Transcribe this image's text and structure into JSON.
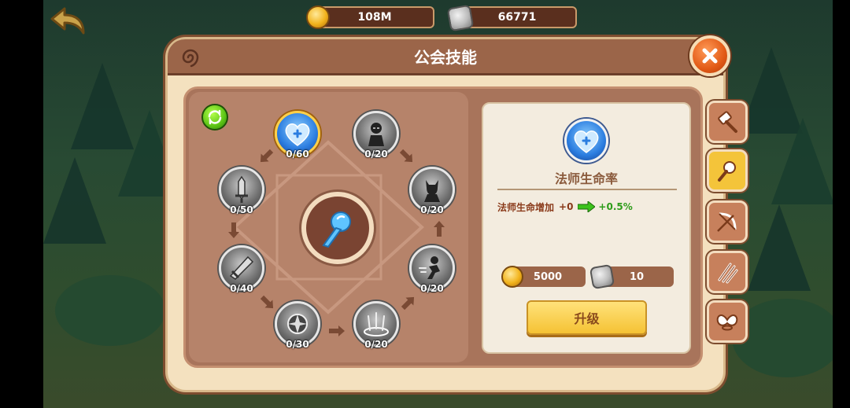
{
  "resources": {
    "gold": "108M",
    "stone": "66771"
  },
  "panel": {
    "title": "公会技能"
  },
  "skills": [
    {
      "name": "mage-health",
      "count": "0/60",
      "active": true
    },
    {
      "name": "assassin",
      "count": "0/20",
      "active": false
    },
    {
      "name": "shadow-warrior",
      "count": "0/20",
      "active": false
    },
    {
      "name": "dash",
      "count": "0/20",
      "active": false
    },
    {
      "name": "shockwave",
      "count": "0/20",
      "active": false
    },
    {
      "name": "spin",
      "count": "0/30",
      "active": false
    },
    {
      "name": "blade",
      "count": "0/40",
      "active": false
    },
    {
      "name": "shield-sword",
      "count": "0/50",
      "active": false
    }
  ],
  "detail": {
    "name": "法师生命率",
    "effect_label": "法师生命增加",
    "effect_current": "+0",
    "effect_next": "+0.5%",
    "cost_gold": "5000",
    "cost_stone": "10",
    "upgrade_label": "升级"
  },
  "side_tabs": [
    {
      "icon": "hammer-icon",
      "active": false
    },
    {
      "icon": "wand-icon",
      "active": true
    },
    {
      "icon": "bow-icon",
      "active": false
    },
    {
      "icon": "claw-icon",
      "active": false
    },
    {
      "icon": "wings-icon",
      "active": false
    }
  ],
  "colors": {
    "title_bar": "#9b6549",
    "panel_bg": "#f4e1bf",
    "positive": "#2d9c1a",
    "upgrade_button": "#f5c234"
  }
}
